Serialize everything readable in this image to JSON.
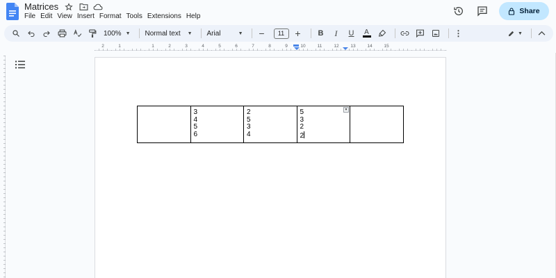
{
  "header": {
    "title": "Matrices",
    "menu": [
      "File",
      "Edit",
      "View",
      "Insert",
      "Format",
      "Tools",
      "Extensions",
      "Help"
    ],
    "share_label": "Share"
  },
  "toolbar": {
    "zoom": "100%",
    "style": "Normal text",
    "font": "Arial",
    "font_size": "11",
    "bold_label": "B",
    "italic_label": "I",
    "underline_label": "U",
    "text_color_label": "A"
  },
  "ruler": {
    "numbers": [
      "2",
      "1",
      "1",
      "2",
      "3",
      "4",
      "5",
      "6",
      "7",
      "8",
      "9",
      "10",
      "11",
      "12",
      "13",
      "14",
      "15"
    ]
  },
  "table": {
    "rows": [
      [
        {
          "lines": []
        },
        {
          "lines": [
            "3",
            "4",
            "5",
            "6"
          ]
        },
        {
          "lines": [
            "2",
            "5",
            "3",
            "4"
          ]
        },
        {
          "lines": [
            "5",
            "3",
            "2",
            "2"
          ]
        },
        {
          "lines": []
        }
      ]
    ]
  },
  "colors": {
    "share_bg": "#c2e7ff",
    "toolbar_bg": "#edf2fa",
    "docs_blue": "#4285f4",
    "ruler_marker": "#4a86e8"
  }
}
